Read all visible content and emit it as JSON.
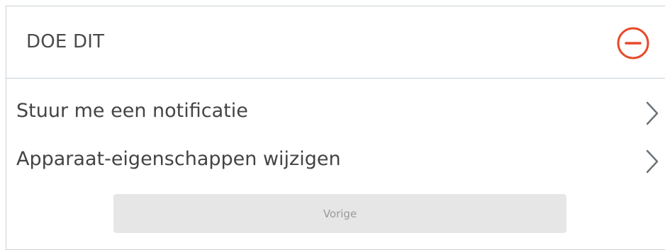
{
  "panel": {
    "title": "DOE DIT",
    "collapse_icon": "minus-circle-icon",
    "accent_color": "#e8492a"
  },
  "actions": [
    {
      "label": "Stuur me een notificatie",
      "icon": "chevron-right-icon"
    },
    {
      "label": "Apparaat-eigenschappen wijzigen",
      "icon": "chevron-right-icon"
    }
  ],
  "footer": {
    "back_label": "Vorige"
  }
}
